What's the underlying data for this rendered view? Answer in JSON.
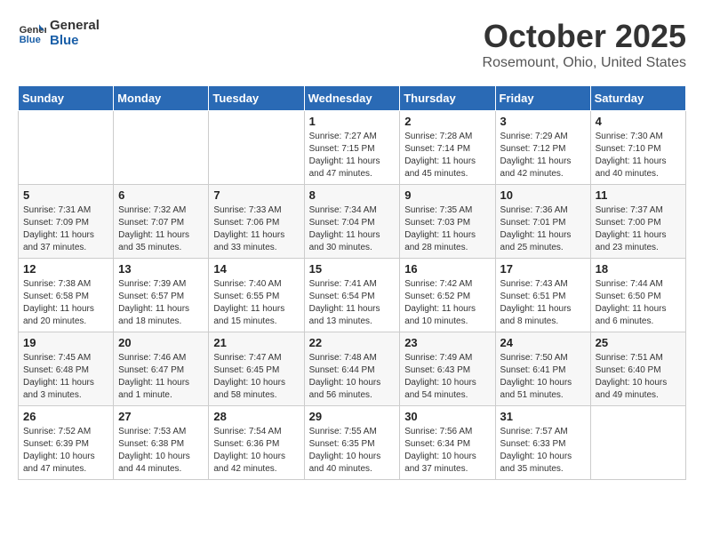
{
  "logo": {
    "line1": "General",
    "line2": "Blue"
  },
  "title": "October 2025",
  "subtitle": "Rosemount, Ohio, United States",
  "days_of_week": [
    "Sunday",
    "Monday",
    "Tuesday",
    "Wednesday",
    "Thursday",
    "Friday",
    "Saturday"
  ],
  "weeks": [
    [
      {
        "day": "",
        "info": ""
      },
      {
        "day": "",
        "info": ""
      },
      {
        "day": "",
        "info": ""
      },
      {
        "day": "1",
        "info": "Sunrise: 7:27 AM\nSunset: 7:15 PM\nDaylight: 11 hours\nand 47 minutes."
      },
      {
        "day": "2",
        "info": "Sunrise: 7:28 AM\nSunset: 7:14 PM\nDaylight: 11 hours\nand 45 minutes."
      },
      {
        "day": "3",
        "info": "Sunrise: 7:29 AM\nSunset: 7:12 PM\nDaylight: 11 hours\nand 42 minutes."
      },
      {
        "day": "4",
        "info": "Sunrise: 7:30 AM\nSunset: 7:10 PM\nDaylight: 11 hours\nand 40 minutes."
      }
    ],
    [
      {
        "day": "5",
        "info": "Sunrise: 7:31 AM\nSunset: 7:09 PM\nDaylight: 11 hours\nand 37 minutes."
      },
      {
        "day": "6",
        "info": "Sunrise: 7:32 AM\nSunset: 7:07 PM\nDaylight: 11 hours\nand 35 minutes."
      },
      {
        "day": "7",
        "info": "Sunrise: 7:33 AM\nSunset: 7:06 PM\nDaylight: 11 hours\nand 33 minutes."
      },
      {
        "day": "8",
        "info": "Sunrise: 7:34 AM\nSunset: 7:04 PM\nDaylight: 11 hours\nand 30 minutes."
      },
      {
        "day": "9",
        "info": "Sunrise: 7:35 AM\nSunset: 7:03 PM\nDaylight: 11 hours\nand 28 minutes."
      },
      {
        "day": "10",
        "info": "Sunrise: 7:36 AM\nSunset: 7:01 PM\nDaylight: 11 hours\nand 25 minutes."
      },
      {
        "day": "11",
        "info": "Sunrise: 7:37 AM\nSunset: 7:00 PM\nDaylight: 11 hours\nand 23 minutes."
      }
    ],
    [
      {
        "day": "12",
        "info": "Sunrise: 7:38 AM\nSunset: 6:58 PM\nDaylight: 11 hours\nand 20 minutes."
      },
      {
        "day": "13",
        "info": "Sunrise: 7:39 AM\nSunset: 6:57 PM\nDaylight: 11 hours\nand 18 minutes."
      },
      {
        "day": "14",
        "info": "Sunrise: 7:40 AM\nSunset: 6:55 PM\nDaylight: 11 hours\nand 15 minutes."
      },
      {
        "day": "15",
        "info": "Sunrise: 7:41 AM\nSunset: 6:54 PM\nDaylight: 11 hours\nand 13 minutes."
      },
      {
        "day": "16",
        "info": "Sunrise: 7:42 AM\nSunset: 6:52 PM\nDaylight: 11 hours\nand 10 minutes."
      },
      {
        "day": "17",
        "info": "Sunrise: 7:43 AM\nSunset: 6:51 PM\nDaylight: 11 hours\nand 8 minutes."
      },
      {
        "day": "18",
        "info": "Sunrise: 7:44 AM\nSunset: 6:50 PM\nDaylight: 11 hours\nand 6 minutes."
      }
    ],
    [
      {
        "day": "19",
        "info": "Sunrise: 7:45 AM\nSunset: 6:48 PM\nDaylight: 11 hours\nand 3 minutes."
      },
      {
        "day": "20",
        "info": "Sunrise: 7:46 AM\nSunset: 6:47 PM\nDaylight: 11 hours\nand 1 minute."
      },
      {
        "day": "21",
        "info": "Sunrise: 7:47 AM\nSunset: 6:45 PM\nDaylight: 10 hours\nand 58 minutes."
      },
      {
        "day": "22",
        "info": "Sunrise: 7:48 AM\nSunset: 6:44 PM\nDaylight: 10 hours\nand 56 minutes."
      },
      {
        "day": "23",
        "info": "Sunrise: 7:49 AM\nSunset: 6:43 PM\nDaylight: 10 hours\nand 54 minutes."
      },
      {
        "day": "24",
        "info": "Sunrise: 7:50 AM\nSunset: 6:41 PM\nDaylight: 10 hours\nand 51 minutes."
      },
      {
        "day": "25",
        "info": "Sunrise: 7:51 AM\nSunset: 6:40 PM\nDaylight: 10 hours\nand 49 minutes."
      }
    ],
    [
      {
        "day": "26",
        "info": "Sunrise: 7:52 AM\nSunset: 6:39 PM\nDaylight: 10 hours\nand 47 minutes."
      },
      {
        "day": "27",
        "info": "Sunrise: 7:53 AM\nSunset: 6:38 PM\nDaylight: 10 hours\nand 44 minutes."
      },
      {
        "day": "28",
        "info": "Sunrise: 7:54 AM\nSunset: 6:36 PM\nDaylight: 10 hours\nand 42 minutes."
      },
      {
        "day": "29",
        "info": "Sunrise: 7:55 AM\nSunset: 6:35 PM\nDaylight: 10 hours\nand 40 minutes."
      },
      {
        "day": "30",
        "info": "Sunrise: 7:56 AM\nSunset: 6:34 PM\nDaylight: 10 hours\nand 37 minutes."
      },
      {
        "day": "31",
        "info": "Sunrise: 7:57 AM\nSunset: 6:33 PM\nDaylight: 10 hours\nand 35 minutes."
      },
      {
        "day": "",
        "info": ""
      }
    ]
  ]
}
